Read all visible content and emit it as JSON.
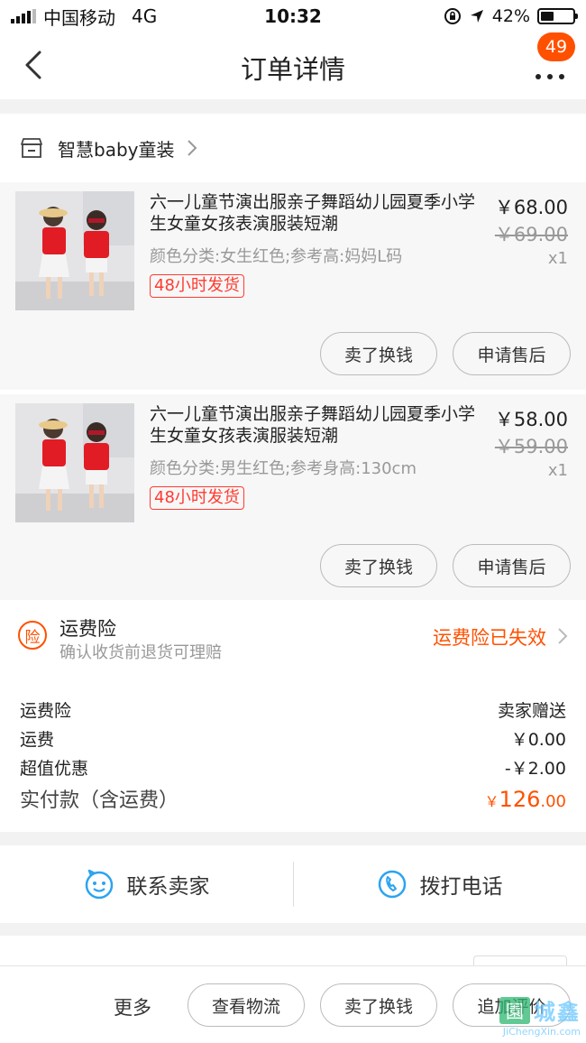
{
  "status_bar": {
    "carrier": "中国移动",
    "network": "4G",
    "time": "10:32",
    "battery_percent": "42%",
    "battery_level": 0.42
  },
  "nav": {
    "title": "订单详情",
    "badge_count": "49"
  },
  "shop": {
    "name": "智慧baby童装"
  },
  "products": [
    {
      "title": "六一儿童节演出服亲子舞蹈幼儿园夏季小学生女童女孩表演服装短潮",
      "spec": "颜色分类:女生红色;参考高:妈妈L码",
      "tag": "48小时发货",
      "price": "￥68.00",
      "original_price": "￥69.00",
      "quantity": "x1",
      "btn_sell": "卖了换钱",
      "btn_after_sale": "申请售后"
    },
    {
      "title": "六一儿童节演出服亲子舞蹈幼儿园夏季小学生女童女孩表演服装短潮",
      "spec": "颜色分类:男生红色;参考身高:130cm",
      "tag": "48小时发货",
      "price": "￥58.00",
      "original_price": "￥59.00",
      "quantity": "x1",
      "btn_sell": "卖了换钱",
      "btn_after_sale": "申请售后"
    }
  ],
  "insurance": {
    "icon_char": "险",
    "title": "运费险",
    "subtitle": "确认收货前退货可理赔",
    "status": "运费险已失效"
  },
  "summary": {
    "rows": [
      {
        "label": "运费险",
        "value": "卖家赠送"
      },
      {
        "label": "运费",
        "value": "￥0.00"
      },
      {
        "label": "超值优惠",
        "value": "-￥2.00"
      }
    ],
    "total_label": "实付款（含运费）",
    "total_currency": "￥",
    "total_integer": "126",
    "total_decimal": ".00"
  },
  "contact": {
    "seller_label": "联系卖家",
    "phone_label": "拨打电话"
  },
  "bottom_bar": {
    "more_label": "更多",
    "btn_logistics": "查看物流",
    "btn_sell": "卖了换钱",
    "btn_review": "追加评价"
  },
  "watermark": {
    "icon_char": "園",
    "text": "城鑫",
    "url": "JiChengXin.com"
  },
  "colors": {
    "accent": "#ff5000",
    "tag_red": "#ff3b30",
    "contact_blue": "#2ba4f0"
  }
}
